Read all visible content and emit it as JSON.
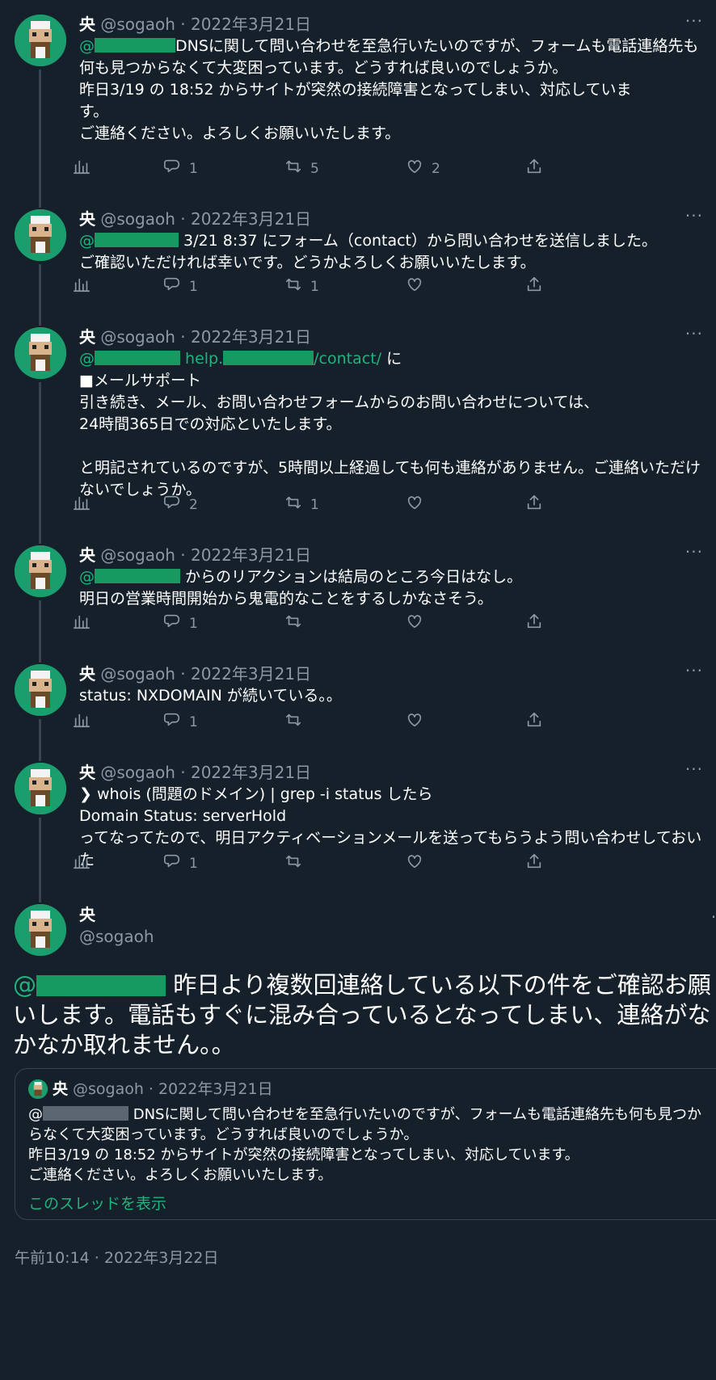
{
  "user": {
    "name": "央",
    "handle": "@sogaoh"
  },
  "dot": "·",
  "more": "···",
  "replies": [
    {
      "date": "2022年3月21日",
      "parts": [
        {
          "t": "mention",
          "v": "@"
        },
        {
          "t": "redact",
          "w": 100
        },
        {
          "t": "text",
          "v": "DNSに関して問い合わせを至急行いたいのですが、フォームも電話連絡先も何も見つからなくて大変困っています。どうすれば良いのでしょうか。\n昨日3/19 の 18:52 からサイトが突然の接続障害となってしまい、対応していま\nす。\nご連絡ください。よろしくお願いいたします。"
        }
      ],
      "reply": "1",
      "retweet": "5",
      "like": "2"
    },
    {
      "date": "2022年3月21日",
      "parts": [
        {
          "t": "mention",
          "v": "@"
        },
        {
          "t": "redact",
          "w": 104
        },
        {
          "t": "text",
          "v": " 3/21 8:37 にフォーム（contact）から問い合わせを送信しました。\nご確認いただければ幸いです。どうかよろしくお願いいたします。"
        }
      ],
      "reply": "1",
      "retweet": "1",
      "like": ""
    },
    {
      "date": "2022年3月21日",
      "parts": [
        {
          "t": "mention",
          "v": "@"
        },
        {
          "t": "redact",
          "w": 106
        },
        {
          "t": "link",
          "v": " help."
        },
        {
          "t": "redact",
          "w": 112
        },
        {
          "t": "link",
          "v": "/contact/"
        },
        {
          "t": "text",
          "v": " に\n■メールサポート\n引き続き、メール、お問い合わせフォームからのお問い合わせについては、\n24時間365日での対応といたします。\n\nと明記されているのですが、5時間以上経過しても何も連絡がありません。ご連絡いただけないでしょうか。"
        }
      ],
      "reply": "2",
      "retweet": "1",
      "like": ""
    },
    {
      "date": "2022年3月21日",
      "parts": [
        {
          "t": "mention",
          "v": "@"
        },
        {
          "t": "redact",
          "w": 106
        },
        {
          "t": "text",
          "v": " からのリアクションは結局のところ今日はなし。\n明日の営業時間開始から鬼電的なことをするしかなさそう。"
        }
      ],
      "reply": "1",
      "retweet": "",
      "like": ""
    },
    {
      "date": "2022年3月21日",
      "parts": [
        {
          "t": "text",
          "v": "status: NXDOMAIN が続いている。。"
        }
      ],
      "reply": "1",
      "retweet": "",
      "like": ""
    },
    {
      "date": "2022年3月21日",
      "parts": [
        {
          "t": "text",
          "v": "❯ whois (問題のドメイン) | grep -i status したら\nDomain Status: serverHold\nってなってたので、明日アクティベーションメールを送ってもらうよう問い合わせしておいた"
        }
      ],
      "reply": "1",
      "retweet": "",
      "like": ""
    }
  ],
  "focal": {
    "mention": "@",
    "text": " 昨日より複数回連絡している以下の件をご確認お願いします。電話もすぐに混み合っているとなってしまい、連絡がなかなか取れません。。",
    "quote": {
      "date": "2022年3月21日",
      "mention": "@",
      "text": " DNSに関して問い合わせを至急行いたいのですが、フォームも電話連絡先も何も見つからなくて大変困っています。どうすれば良いのでしょうか。\n昨日3/19 の 18:52 からサイトが突然の接続障害となってしまい、対応しています。\nご連絡ください。よろしくお願いいたします。",
      "show_thread": "このスレッドを表示"
    },
    "timestamp": "午前10:14 · 2022年3月22日"
  },
  "colors": {
    "bg": "#15202b",
    "accent": "#1db47d",
    "muted": "#8b98a5",
    "border": "#38444d"
  },
  "icons": [
    "analytics-icon",
    "reply-icon",
    "retweet-icon",
    "like-icon",
    "share-icon",
    "more-icon"
  ]
}
